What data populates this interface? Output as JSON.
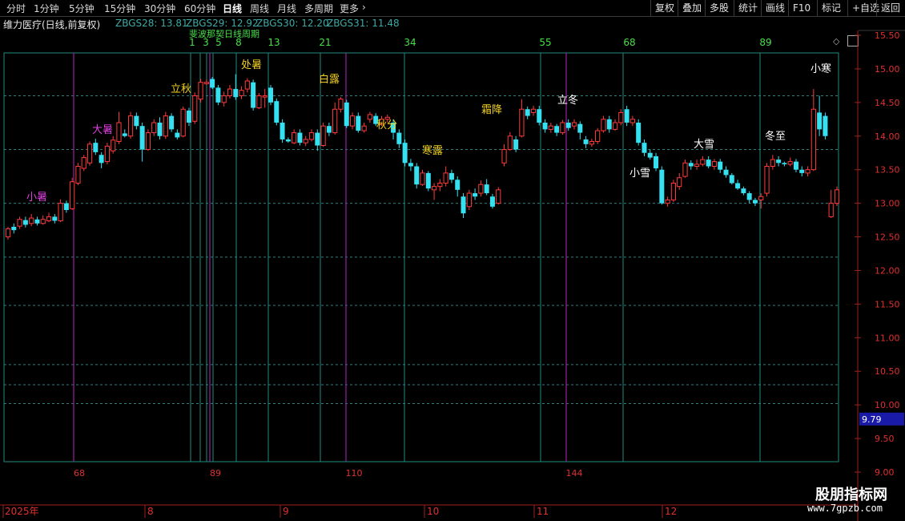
{
  "toolbar": {
    "left": [
      {
        "label": "分时",
        "x": 8
      },
      {
        "label": "1分钟",
        "x": 42
      },
      {
        "label": "5分钟",
        "x": 86
      },
      {
        "label": "15分钟",
        "x": 130
      },
      {
        "label": "30分钟",
        "x": 180
      },
      {
        "label": "60分钟",
        "x": 230
      },
      {
        "label": "日线",
        "x": 278,
        "active": true
      },
      {
        "label": "周线",
        "x": 312
      },
      {
        "label": "月线",
        "x": 346
      },
      {
        "label": "多周期",
        "x": 380
      },
      {
        "label": "更多",
        "x": 424
      }
    ],
    "more_arrow": "›",
    "right": [
      "复权",
      "叠加",
      "多股",
      "统计",
      "画线",
      "F10",
      "标记",
      "+自选",
      "返回"
    ]
  },
  "info": {
    "title": "维力医疗(日线,前复权)",
    "indicators": [
      "ZBGS28: 13.81",
      "ZBGS29: 12.92",
      "ZBGS30: 12.20",
      "ZBGS31: 11.48"
    ]
  },
  "colors": {
    "up": "#ff3b3b",
    "down": "#35e0f0",
    "grid": "#2f7e7e",
    "axis": "#a02020",
    "cyan_line": "#1f8a80",
    "magenta_line": "#9b1fa0",
    "price_label": "#e03030",
    "current_price_bg": "#1a1aa8"
  },
  "price_axis": {
    "ticks": [
      "15.50",
      "15.00",
      "14.50",
      "14.00",
      "13.50",
      "13.00",
      "12.50",
      "12.00",
      "11.50",
      "11.00",
      "10.50",
      "10.00",
      "9.50",
      "9.00"
    ],
    "current": "9.79"
  },
  "cycle_numbers": [
    "1",
    "3",
    "5",
    "8",
    "13",
    "21",
    "34",
    "55",
    "68",
    "89"
  ],
  "cycle_overlay_text": "斐波那契日线周期",
  "bottom_numbers": [
    "68",
    "89",
    "110",
    "144"
  ],
  "date_axis": [
    "2025年",
    "8",
    "9",
    "10",
    "11",
    "12"
  ],
  "solar_terms": [
    {
      "text": "小暑",
      "color": "#e040e0"
    },
    {
      "text": "大暑",
      "color": "#e040e0"
    },
    {
      "text": "立秋",
      "color": "#f0d020"
    },
    {
      "text": "处暑",
      "color": "#f0d020"
    },
    {
      "text": "白露",
      "color": "#f0d020"
    },
    {
      "text": "秋分",
      "color": "#f0d020"
    },
    {
      "text": "寒露",
      "color": "#f0d020"
    },
    {
      "text": "霜降",
      "color": "#f0d020"
    },
    {
      "text": "立冬",
      "color": "#ffffff"
    },
    {
      "text": "小雪",
      "color": "#ffffff"
    },
    {
      "text": "大雪",
      "color": "#ffffff"
    },
    {
      "text": "冬至",
      "color": "#ffffff"
    },
    {
      "text": "小寒",
      "color": "#ffffff"
    }
  ],
  "chart_data": {
    "type": "candlestick",
    "y_range": [
      9.0,
      15.5
    ],
    "candles": [
      [
        12.5,
        12.62,
        12.46,
        12.65
      ],
      [
        12.65,
        12.6,
        12.55,
        12.7
      ],
      [
        12.66,
        12.76,
        12.62,
        12.8
      ],
      [
        12.75,
        12.68,
        12.64,
        12.8
      ],
      [
        12.7,
        12.78,
        12.66,
        12.84
      ],
      [
        12.76,
        12.7,
        12.67,
        12.8
      ],
      [
        12.7,
        12.76,
        12.68,
        12.82
      ],
      [
        12.74,
        12.8,
        12.72,
        12.86
      ],
      [
        12.8,
        12.74,
        12.7,
        12.84
      ],
      [
        12.74,
        13.0,
        12.72,
        13.06
      ],
      [
        13.0,
        12.9,
        12.86,
        13.04
      ],
      [
        12.92,
        13.32,
        12.9,
        13.38
      ],
      [
        13.3,
        13.55,
        13.27,
        13.6
      ],
      [
        13.52,
        13.68,
        13.48,
        13.72
      ],
      [
        13.6,
        13.88,
        13.56,
        13.92
      ],
      [
        13.9,
        13.76,
        13.72,
        13.96
      ],
      [
        13.72,
        13.6,
        13.52,
        13.76
      ],
      [
        13.62,
        13.85,
        13.58,
        13.9
      ],
      [
        13.78,
        13.94,
        13.74,
        14.0
      ],
      [
        13.92,
        14.2,
        13.88,
        14.36
      ],
      [
        14.04,
        14.0,
        13.98,
        14.1
      ],
      [
        14.0,
        14.3,
        13.96,
        14.36
      ],
      [
        14.3,
        14.15,
        14.1,
        14.35
      ],
      [
        14.15,
        13.8,
        13.62,
        14.2
      ],
      [
        13.8,
        14.05,
        13.78,
        14.1
      ],
      [
        14.05,
        14.2,
        14.0,
        14.25
      ],
      [
        14.2,
        14.0,
        13.95,
        14.28
      ],
      [
        14.0,
        14.3,
        13.96,
        14.36
      ],
      [
        14.3,
        14.1,
        14.06,
        14.34
      ],
      [
        14.05,
        13.98,
        13.95,
        14.1
      ],
      [
        14.0,
        14.4,
        13.98,
        14.44
      ],
      [
        14.38,
        14.2,
        14.15,
        14.42
      ],
      [
        14.22,
        14.6,
        14.18,
        14.65
      ],
      [
        14.55,
        14.8,
        14.5,
        14.85
      ],
      [
        14.78,
        14.8,
        14.76,
        14.84
      ],
      [
        14.85,
        14.72,
        14.7,
        14.88
      ],
      [
        14.72,
        14.5,
        14.46,
        14.76
      ],
      [
        14.5,
        14.6,
        14.44,
        14.66
      ],
      [
        14.6,
        14.7,
        14.56,
        14.76
      ],
      [
        14.7,
        14.58,
        14.54,
        14.92
      ],
      [
        14.6,
        14.68,
        14.55,
        14.74
      ],
      [
        14.7,
        14.82,
        14.65,
        14.86
      ],
      [
        14.8,
        14.42,
        14.38,
        14.84
      ],
      [
        14.42,
        14.6,
        14.4,
        14.64
      ],
      [
        14.58,
        14.6,
        14.42,
        14.7
      ],
      [
        14.72,
        14.5,
        14.46,
        14.76
      ],
      [
        14.52,
        14.2,
        14.16,
        14.56
      ],
      [
        14.2,
        13.95,
        13.9,
        14.25
      ],
      [
        13.95,
        13.92,
        13.9,
        13.98
      ],
      [
        13.9,
        14.05,
        13.88,
        14.1
      ],
      [
        14.05,
        13.9,
        13.86,
        14.1
      ],
      [
        13.9,
        13.95,
        13.85,
        14.0
      ],
      [
        13.95,
        14.05,
        13.92,
        14.1
      ],
      [
        14.05,
        13.86,
        13.78,
        14.1
      ],
      [
        13.86,
        14.15,
        13.84,
        14.2
      ],
      [
        14.15,
        14.05,
        14.0,
        14.2
      ],
      [
        14.05,
        14.4,
        14.02,
        14.5
      ],
      [
        14.4,
        14.55,
        14.35,
        14.58
      ],
      [
        14.5,
        14.15,
        14.12,
        14.54
      ],
      [
        14.15,
        14.3,
        14.1,
        14.35
      ],
      [
        14.3,
        14.08,
        14.05,
        14.35
      ],
      [
        14.08,
        14.15,
        14.05,
        14.2
      ],
      [
        14.25,
        14.32,
        14.2,
        14.36
      ],
      [
        14.3,
        14.18,
        14.15,
        14.34
      ],
      [
        14.18,
        14.25,
        14.15,
        14.3
      ],
      [
        14.25,
        14.28,
        14.2,
        14.32
      ],
      [
        14.2,
        14.05,
        13.95,
        14.25
      ],
      [
        14.05,
        13.88,
        13.82,
        14.1
      ],
      [
        13.9,
        13.6,
        13.55,
        13.95
      ],
      [
        13.6,
        13.55,
        13.48,
        13.66
      ],
      [
        13.55,
        13.28,
        13.22,
        13.6
      ],
      [
        13.28,
        13.45,
        13.26,
        13.5
      ],
      [
        13.45,
        13.22,
        13.18,
        13.48
      ],
      [
        13.2,
        13.25,
        13.05,
        13.3
      ],
      [
        13.25,
        13.3,
        13.18,
        13.36
      ],
      [
        13.3,
        13.45,
        13.25,
        13.55
      ],
      [
        13.45,
        13.35,
        13.3,
        13.5
      ],
      [
        13.35,
        13.2,
        13.1,
        13.4
      ],
      [
        13.1,
        12.85,
        12.78,
        13.15
      ],
      [
        12.95,
        13.15,
        12.9,
        13.2
      ],
      [
        13.15,
        13.1,
        13.05,
        13.22
      ],
      [
        13.15,
        13.28,
        13.1,
        13.34
      ],
      [
        13.28,
        13.15,
        13.12,
        13.36
      ],
      [
        13.1,
        12.95,
        12.92,
        13.14
      ],
      [
        13.0,
        13.2,
        12.98,
        13.24
      ],
      [
        13.6,
        13.8,
        13.55,
        13.88
      ],
      [
        13.8,
        14.0,
        13.78,
        14.06
      ],
      [
        13.95,
        13.8,
        13.76,
        14.0
      ],
      [
        14.0,
        14.4,
        13.98,
        14.55
      ],
      [
        14.4,
        14.3,
        14.25,
        14.44
      ],
      [
        14.35,
        14.4,
        14.3,
        14.45
      ],
      [
        14.4,
        14.2,
        14.16,
        14.45
      ],
      [
        14.2,
        14.1,
        14.05,
        14.25
      ],
      [
        14.1,
        14.15,
        14.05,
        14.2
      ],
      [
        14.15,
        14.05,
        14.0,
        14.18
      ],
      [
        14.05,
        14.2,
        14.02,
        14.24
      ],
      [
        14.2,
        14.12,
        14.08,
        14.25
      ],
      [
        14.15,
        14.2,
        14.1,
        14.25
      ],
      [
        14.18,
        14.05,
        13.95,
        14.22
      ],
      [
        13.95,
        13.88,
        13.82,
        14.0
      ],
      [
        13.88,
        13.92,
        13.84,
        13.96
      ],
      [
        13.92,
        14.08,
        13.88,
        14.12
      ],
      [
        14.08,
        14.25,
        14.05,
        14.3
      ],
      [
        14.25,
        14.1,
        14.05,
        14.3
      ],
      [
        14.1,
        14.2,
        14.08,
        14.25
      ],
      [
        14.2,
        14.35,
        14.16,
        14.4
      ],
      [
        14.4,
        14.2,
        14.15,
        14.45
      ],
      [
        14.2,
        14.25,
        14.15,
        14.3
      ],
      [
        14.2,
        13.9,
        13.86,
        14.25
      ],
      [
        13.9,
        13.75,
        13.7,
        13.95
      ],
      [
        13.75,
        13.68,
        13.65,
        13.8
      ],
      [
        13.7,
        13.52,
        13.48,
        13.75
      ],
      [
        13.5,
        13.0,
        12.98,
        13.55
      ],
      [
        13.0,
        13.05,
        12.95,
        13.1
      ],
      [
        13.05,
        13.3,
        13.02,
        13.35
      ],
      [
        13.25,
        13.38,
        13.2,
        13.45
      ],
      [
        13.4,
        13.6,
        13.38,
        13.65
      ],
      [
        13.6,
        13.55,
        13.5,
        13.64
      ],
      [
        13.55,
        13.58,
        13.5,
        13.65
      ],
      [
        13.58,
        13.65,
        13.55,
        13.7
      ],
      [
        13.65,
        13.55,
        13.52,
        13.7
      ],
      [
        13.55,
        13.62,
        13.5,
        13.66
      ],
      [
        13.62,
        13.5,
        13.45,
        13.66
      ],
      [
        13.5,
        13.42,
        13.38,
        13.55
      ],
      [
        13.42,
        13.3,
        13.28,
        13.45
      ],
      [
        13.3,
        13.22,
        13.2,
        13.35
      ],
      [
        13.22,
        13.15,
        13.12,
        13.25
      ],
      [
        13.15,
        13.05,
        13.0,
        13.18
      ],
      [
        13.05,
        13.0,
        12.96,
        13.08
      ],
      [
        13.05,
        13.1,
        12.92,
        13.15
      ],
      [
        13.15,
        13.55,
        13.1,
        13.6
      ],
      [
        13.55,
        13.65,
        13.5,
        13.72
      ],
      [
        13.65,
        13.6,
        13.55,
        13.7
      ],
      [
        13.6,
        13.58,
        13.55,
        13.62
      ],
      [
        13.58,
        13.62,
        13.55,
        13.68
      ],
      [
        13.62,
        13.5,
        13.46,
        13.66
      ],
      [
        13.5,
        13.45,
        13.4,
        13.55
      ],
      [
        13.45,
        13.5,
        13.4,
        13.55
      ],
      [
        13.5,
        14.4,
        13.48,
        14.7
      ],
      [
        14.35,
        14.1,
        14.0,
        14.6
      ],
      [
        14.3,
        14.0,
        13.95,
        14.35
      ],
      [
        12.8,
        13.0,
        12.78,
        13.2
      ],
      [
        13.0,
        13.2,
        12.96,
        13.25
      ]
    ]
  }
}
